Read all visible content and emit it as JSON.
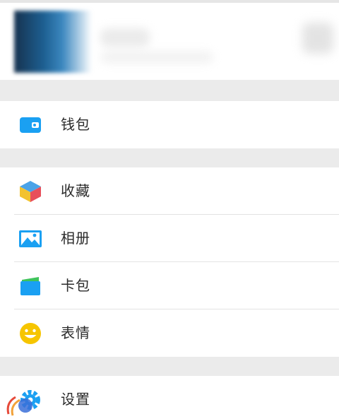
{
  "profile": {
    "avatar": "blurred-avatar",
    "qr": "blurred-qr-icon"
  },
  "menu": {
    "wallet": {
      "label": "钱包",
      "icon": "wallet-icon",
      "color": "#1aa0f2"
    },
    "favorites": {
      "label": "收藏",
      "icon": "cube-icon"
    },
    "album": {
      "label": "相册",
      "icon": "picture-icon",
      "color": "#1aa0f2"
    },
    "cards": {
      "label": "卡包",
      "icon": "card-icon"
    },
    "stickers": {
      "label": "表情",
      "icon": "smiley-icon",
      "color": "#f6c500"
    },
    "settings": {
      "label": "设置",
      "icon": "gear-icon",
      "color": "#1aa0f2"
    }
  },
  "colors": {
    "background": "#ebebeb",
    "card": "#ffffff",
    "accent_blue": "#1aa0f2"
  }
}
